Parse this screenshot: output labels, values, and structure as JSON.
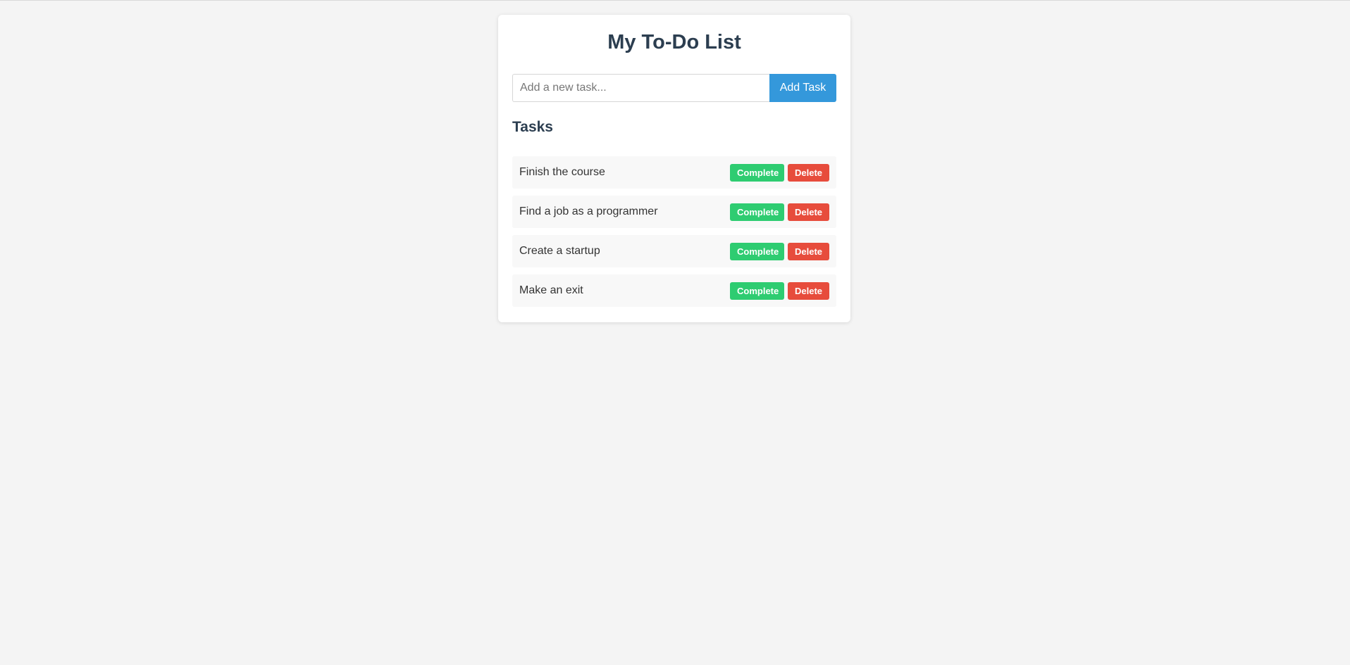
{
  "app": {
    "title": "My To-Do List"
  },
  "add_form": {
    "input_placeholder": "Add a new task...",
    "input_value": "",
    "add_label": "Add Task"
  },
  "tasks_section": {
    "heading": "Tasks",
    "complete_label": "Complete",
    "delete_label": "Delete",
    "items": [
      {
        "text": "Finish the course"
      },
      {
        "text": "Find a job as a programmer"
      },
      {
        "text": "Create a startup"
      },
      {
        "text": "Make an exit"
      }
    ]
  },
  "colors": {
    "page_background": "#f4f4f4",
    "title": "#2c3e50",
    "add_button": "#3498db",
    "complete_button": "#2ecc71",
    "delete_button": "#e74c3c"
  }
}
